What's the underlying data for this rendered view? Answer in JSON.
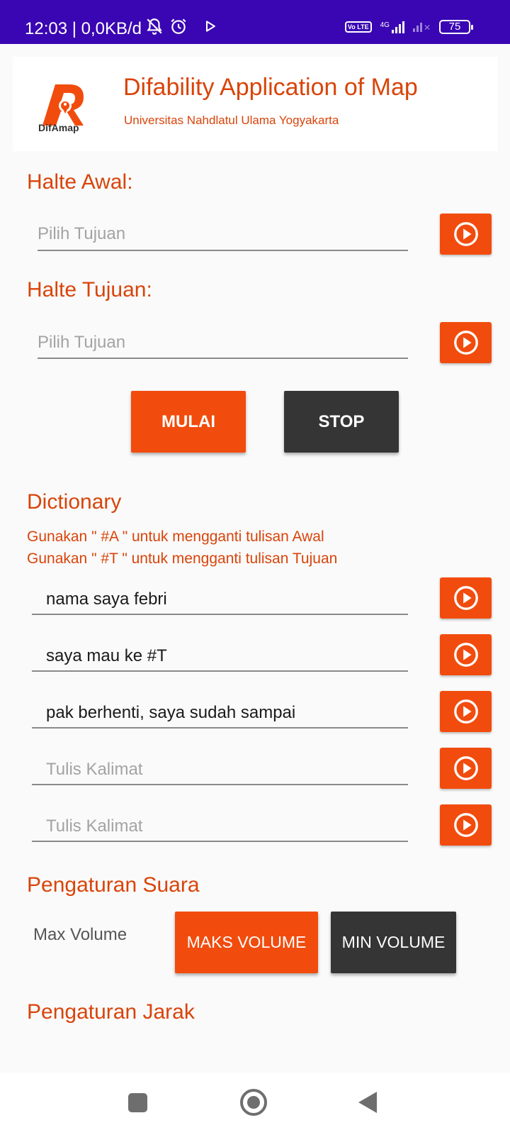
{
  "status_bar": {
    "time": "12:03",
    "network_speed": "| 0,0KB/d",
    "icons": [
      "mute-notification-icon",
      "alarm-icon",
      "play-store-icon",
      "volte-icon",
      "signal-4g-icon",
      "signal-no-sim-icon",
      "battery-icon"
    ],
    "volte_label": "Vo LTE",
    "network_type": "4G",
    "battery_level": "75"
  },
  "header": {
    "logo_text": "DifAmap",
    "title": "Difability Application of Map",
    "subtitle": "Universitas Nahdlatul Ulama Yogyakarta"
  },
  "halte_awal": {
    "label": "Halte Awal:",
    "placeholder": "Pilih Tujuan"
  },
  "halte_tujuan": {
    "label": "Halte Tujuan:",
    "placeholder": "Pilih Tujuan"
  },
  "actions": {
    "start_label": "MULAI",
    "stop_label": "STOP"
  },
  "dictionary": {
    "title": "Dictionary",
    "hint_awal": "Gunakan \" #A \" untuk mengganti tulisan Awal",
    "hint_tujuan": "Gunakan \" #T \" untuk mengganti tulisan Tujuan",
    "entries": [
      {
        "value": "nama saya febri",
        "placeholder": ""
      },
      {
        "value": "saya mau ke #T",
        "placeholder": ""
      },
      {
        "value": "pak berhenti, saya sudah sampai",
        "placeholder": ""
      },
      {
        "value": "",
        "placeholder": "Tulis Kalimat"
      },
      {
        "value": "",
        "placeholder": "Tulis Kalimat"
      }
    ]
  },
  "sound_settings": {
    "title": "Pengaturan Suara",
    "volume_label": "Max Volume",
    "max_button": "MAKS VOLUME",
    "min_button": "MIN VOLUME"
  },
  "distance_settings": {
    "title": "Pengaturan Jarak"
  },
  "colors": {
    "status_bar": "#3a06b3",
    "accent": "#f14c0d",
    "accent_text": "#d9440a",
    "dark_button": "#353535"
  }
}
